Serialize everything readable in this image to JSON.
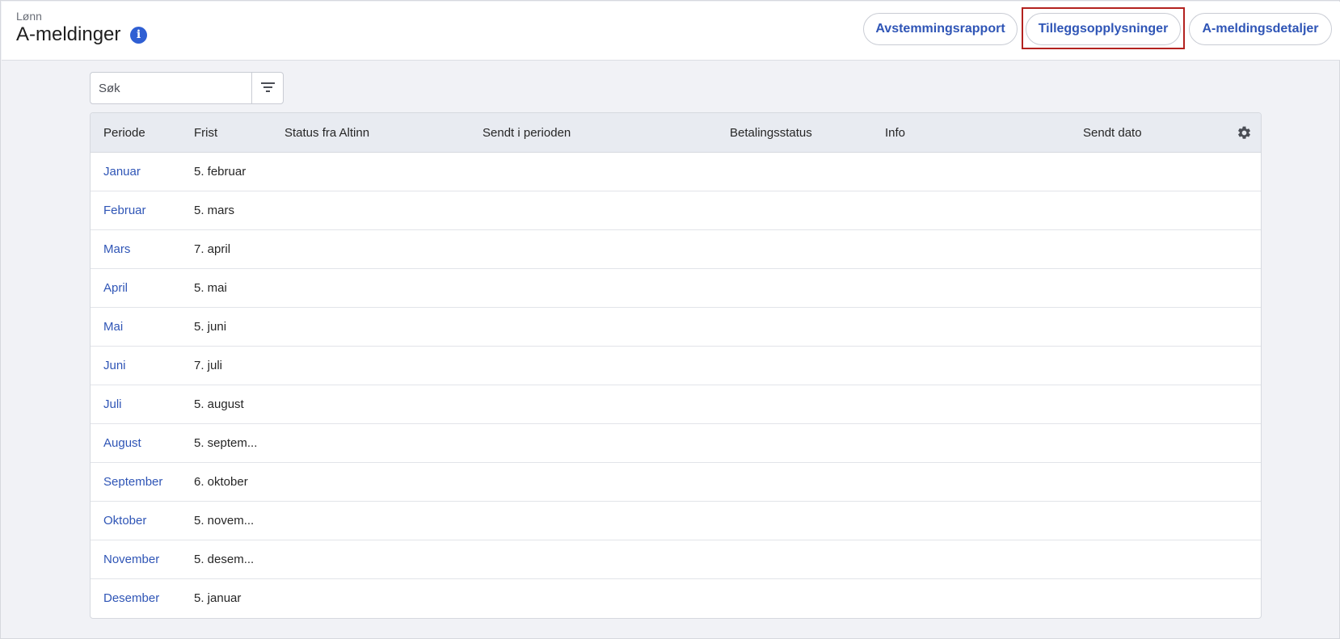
{
  "header": {
    "breadcrumb": "Lønn",
    "title": "A-meldinger",
    "buttons": [
      "Avstemmingsrapport",
      "Tilleggsopplysninger",
      "A-meldingsdetaljer"
    ]
  },
  "search": {
    "placeholder": "Søk",
    "value": ""
  },
  "table": {
    "columns": [
      "Periode",
      "Frist",
      "Status fra Altinn",
      "Sendt i perioden",
      "Betalingsstatus",
      "Info",
      "Sendt dato"
    ],
    "rows": [
      {
        "period": "Januar",
        "deadline": "5. februar"
      },
      {
        "period": "Februar",
        "deadline": "5. mars"
      },
      {
        "period": "Mars",
        "deadline": "7. april"
      },
      {
        "period": "April",
        "deadline": "5. mai"
      },
      {
        "period": "Mai",
        "deadline": "5. juni"
      },
      {
        "period": "Juni",
        "deadline": "7. juli"
      },
      {
        "period": "Juli",
        "deadline": "5. august"
      },
      {
        "period": "August",
        "deadline": "5. septem..."
      },
      {
        "period": "September",
        "deadline": "6. oktober"
      },
      {
        "period": "Oktober",
        "deadline": "5. novem..."
      },
      {
        "period": "November",
        "deadline": "5. desem..."
      },
      {
        "period": "Desember",
        "deadline": "5. januar"
      }
    ]
  },
  "icons": {
    "info": "info-icon",
    "filter": "filter-icon",
    "settings": "gear-icon"
  },
  "colors": {
    "link": "#2f55b6",
    "info_badge": "#2f5fd3",
    "highlight_border": "#b3221f",
    "header_row_bg": "#e8ebf1",
    "page_bg": "#f1f2f6"
  }
}
